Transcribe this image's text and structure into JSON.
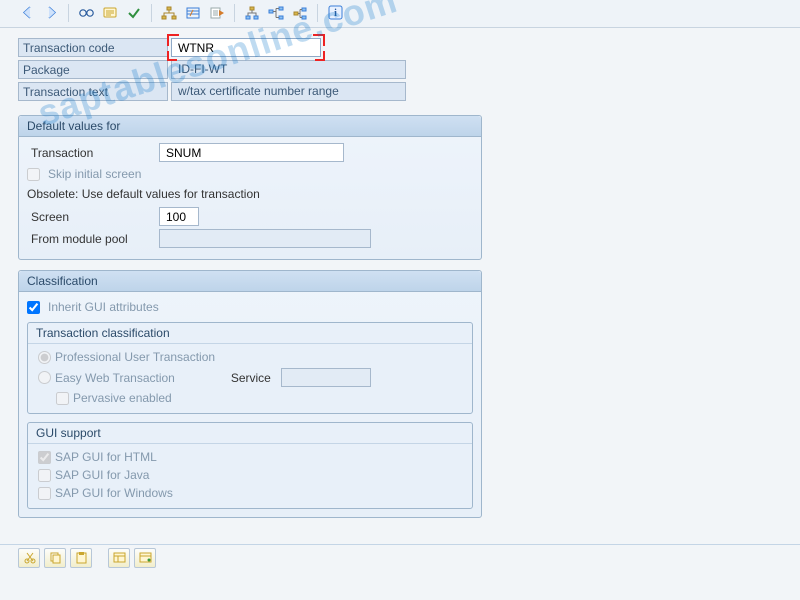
{
  "toolbar": {
    "icons": [
      "back",
      "forward",
      "glasses",
      "display",
      "activate",
      "tree1",
      "tree2",
      "tree3",
      "hier1",
      "hier2",
      "hier3",
      "info"
    ]
  },
  "header": {
    "tcode_label": "Transaction code",
    "tcode_value": "WTNR",
    "package_label": "Package",
    "package_value": "ID-FI-WT",
    "ttext_label": "Transaction text",
    "ttext_value": "w/tax certificate number range"
  },
  "defaults": {
    "title": "Default values for",
    "transaction_label": "Transaction",
    "transaction_value": "SNUM",
    "skip_initial": "Skip initial screen",
    "skip_initial_checked": false,
    "obsolete": "Obsolete: Use default values for transaction",
    "screen_label": "Screen",
    "screen_value": "100",
    "module_pool_label": "From module pool",
    "module_pool_value": ""
  },
  "classification": {
    "title": "Classification",
    "inherit_label": "Inherit GUI attributes",
    "inherit_checked": true,
    "sub_title": "Transaction classification",
    "radio_professional": "Professional User Transaction",
    "radio_easyweb": "Easy Web Transaction",
    "service_label": "Service",
    "service_value": "",
    "pervasive": "Pervasive enabled",
    "selected_radio": "professional",
    "gui": {
      "title": "GUI support",
      "html_label": "SAP GUI for HTML",
      "html_checked": true,
      "java_label": "SAP GUI for Java",
      "java_checked": false,
      "win_label": "SAP GUI for Windows",
      "win_checked": false
    }
  },
  "footer": {
    "buttons": [
      "cut",
      "copy",
      "paste",
      "undo",
      "redo"
    ]
  },
  "colors": {
    "readonly_bg": "#dbe6f3",
    "group_border": "#9fb6cc",
    "focus_red": "#e22"
  },
  "watermark": "saptablesonline.com"
}
